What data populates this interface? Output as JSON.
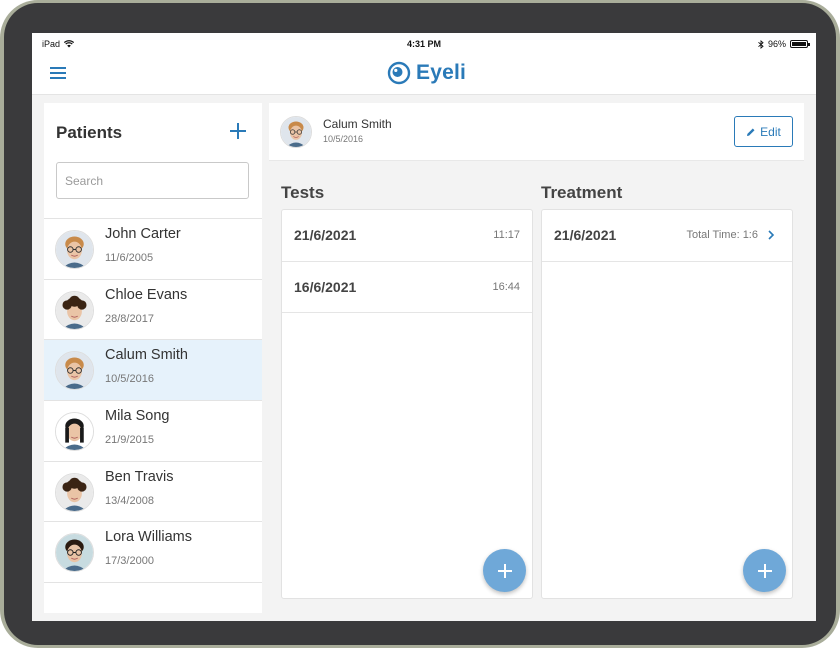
{
  "status_bar": {
    "carrier": "iPad",
    "time": "4:31 PM",
    "battery": "96%",
    "battery_level": 0.96
  },
  "app": {
    "name": "Eyeli"
  },
  "patients_panel": {
    "title": "Patients",
    "search_placeholder": "Search",
    "patients": [
      {
        "name": "John Carter",
        "dob": "11/6/2005",
        "avatar": "boy-glasses",
        "selected": false
      },
      {
        "name": "Chloe Evans",
        "dob": "28/8/2017",
        "avatar": "girl-curly",
        "selected": false
      },
      {
        "name": "Calum Smith",
        "dob": "10/5/2016",
        "avatar": "boy-glasses",
        "selected": true
      },
      {
        "name": "Mila Song",
        "dob": "21/9/2015",
        "avatar": "girl-long-hair",
        "selected": false
      },
      {
        "name": "Ben Travis",
        "dob": "13/4/2008",
        "avatar": "girl-curly",
        "selected": false
      },
      {
        "name": "Lora Williams",
        "dob": "17/3/2000",
        "avatar": "woman-glasses",
        "selected": false
      }
    ]
  },
  "detail": {
    "patient_name": "Calum Smith",
    "patient_dob": "10/5/2016",
    "edit_label": "Edit",
    "tests": {
      "title": "Tests",
      "items": [
        {
          "date": "21/6/2021",
          "time": "11:17"
        },
        {
          "date": "16/6/2021",
          "time": "16:44"
        }
      ]
    },
    "treatment": {
      "title": "Treatment",
      "items": [
        {
          "date": "21/6/2021",
          "total": "Total Time: 1:6"
        }
      ]
    }
  },
  "colors": {
    "accent": "#2a7ab8",
    "fab": "#6fa8d8",
    "selected_row": "#e6f2fb",
    "bezel": "#3a3a3c"
  }
}
